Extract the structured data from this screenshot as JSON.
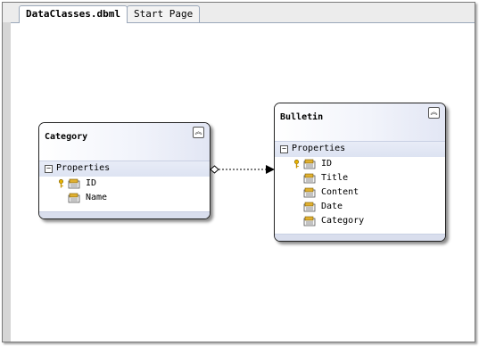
{
  "tabs": [
    {
      "label": "DataClasses.dbml",
      "active": true
    },
    {
      "label": "Start Page",
      "active": false
    }
  ],
  "entities": {
    "category": {
      "title": "Category",
      "section_label": "Properties",
      "properties": [
        {
          "name": "ID",
          "primary_key": true
        },
        {
          "name": "Name",
          "primary_key": false
        }
      ]
    },
    "bulletin": {
      "title": "Bulletin",
      "section_label": "Properties",
      "properties": [
        {
          "name": "ID",
          "primary_key": true
        },
        {
          "name": "Title",
          "primary_key": false
        },
        {
          "name": "Content",
          "primary_key": false
        },
        {
          "name": "Date",
          "primary_key": false
        },
        {
          "name": "Category",
          "primary_key": false
        }
      ]
    }
  },
  "icons": {
    "collapse": "double-chevron-up-icon",
    "section_toggle": "minus-box-icon",
    "primary_key": "key-icon",
    "property": "property-icon"
  },
  "colors": {
    "tab_border": "#9aa7b9",
    "entity_section": "#dde3f2",
    "connector": "#000000"
  }
}
